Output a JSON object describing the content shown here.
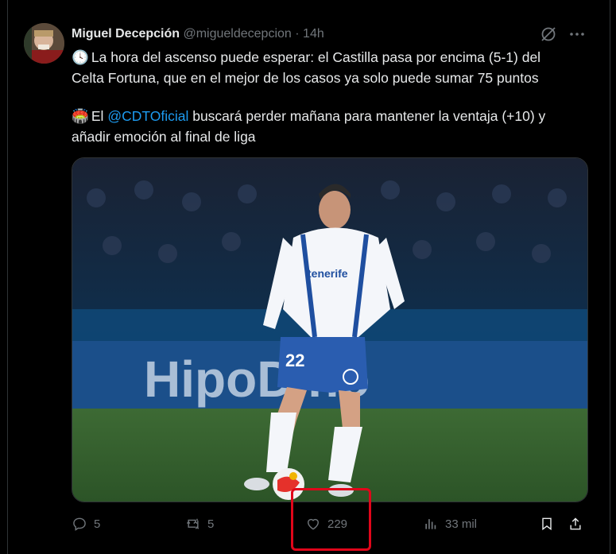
{
  "tweet": {
    "author_name": "Miguel Decepción",
    "handle": "@migueldecepcion",
    "separator": "·",
    "time": "14h",
    "line1_emoji": "🕓",
    "line1": "La hora del ascenso puede esperar: el Castilla pasa por encima (5-1) del",
    "line2": "Celta Fortuna, que en el mejor de los casos ya solo puede sumar 75 puntos",
    "line3_emoji": "🏟️",
    "line3_pre": "El ",
    "line3_mention": "@CDTOficial",
    "line3_post": " buscará perder mañana para mantener la ventaja (+10) y",
    "line4": "añadir emoción al final de liga"
  },
  "media": {
    "banner_text": "HipoDino",
    "shirt_sponsor": "tenerife",
    "shirt_number": "22"
  },
  "actions": {
    "replies": "5",
    "reposts": "5",
    "likes": "229",
    "views": "33 mil"
  },
  "colors": {
    "accent": "#1d9bf0",
    "muted": "#71767b",
    "annotation": "#e0061a"
  },
  "icons": [
    "grok-icon",
    "more-icon",
    "reply-icon",
    "repost-icon",
    "like-icon",
    "views-icon",
    "bookmark-icon",
    "share-icon"
  ]
}
